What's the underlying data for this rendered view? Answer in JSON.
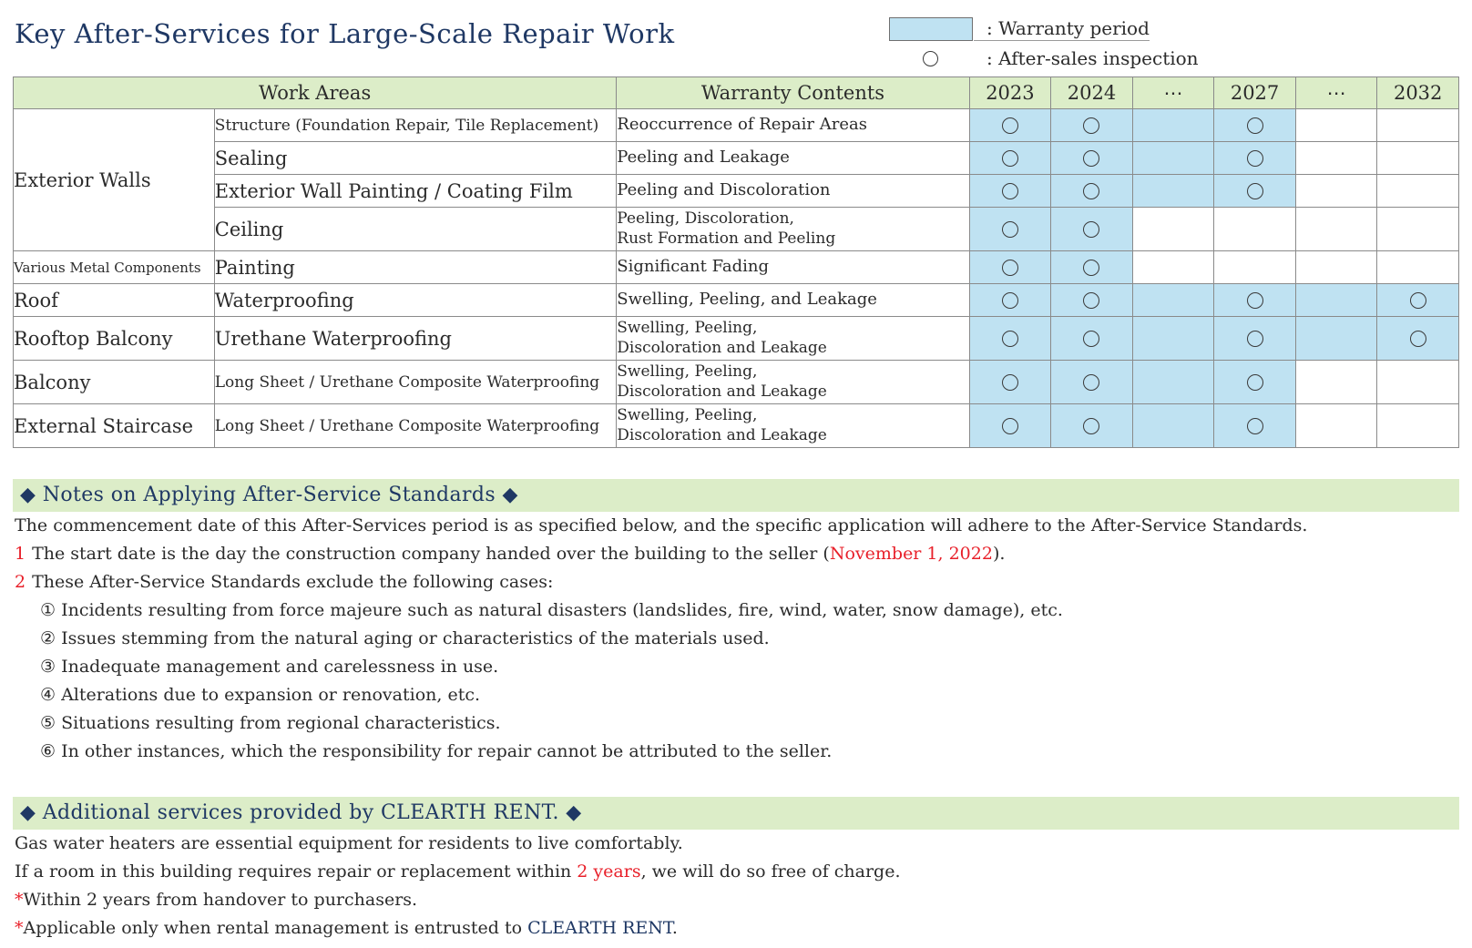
{
  "title": "Key After-Services for Large-Scale Repair Work",
  "legend": [
    {
      "type": "swatch",
      "text": ": Warranty period"
    },
    {
      "type": "circle",
      "text": ": After-sales inspection"
    }
  ],
  "table": {
    "headers": {
      "work_areas": "Work Areas",
      "warranty_contents": "Warranty Contents",
      "years": [
        "2023",
        "2024",
        "⋯",
        "2027",
        "⋯",
        "2032"
      ]
    },
    "rows": [
      {
        "area": "Exterior Walls",
        "area_rowspan": 4,
        "area_small": false,
        "sub": "Structure (Foundation Repair, Tile Replacement)",
        "sub_small": true,
        "warranty": "Reoccurrence of Repair Areas",
        "warranty_line2": "",
        "fill": [
          true,
          true,
          true,
          true,
          false,
          false
        ],
        "marks": [
          true,
          true,
          false,
          true,
          false,
          false
        ]
      },
      {
        "area": "",
        "sub": "Sealing",
        "sub_small": false,
        "warranty": "Peeling and Leakage",
        "warranty_line2": "",
        "fill": [
          true,
          true,
          true,
          true,
          false,
          false
        ],
        "marks": [
          true,
          true,
          false,
          true,
          false,
          false
        ]
      },
      {
        "area": "",
        "sub": "Exterior Wall Painting / Coating Film",
        "sub_small": false,
        "warranty": "Peeling and Discoloration",
        "warranty_line2": "",
        "fill": [
          true,
          true,
          true,
          true,
          false,
          false
        ],
        "marks": [
          true,
          true,
          false,
          true,
          false,
          false
        ]
      },
      {
        "area": "",
        "sub": "Ceiling",
        "sub_small": false,
        "warranty": "Peeling, Discoloration,",
        "warranty_line2": "Rust Formation and Peeling",
        "fill": [
          true,
          true,
          false,
          false,
          false,
          false
        ],
        "marks": [
          true,
          true,
          false,
          false,
          false,
          false
        ]
      },
      {
        "area": "Various Metal Components",
        "area_rowspan": 1,
        "area_small": true,
        "sub": "Painting",
        "sub_small": false,
        "warranty": "Significant Fading",
        "warranty_line2": "",
        "fill": [
          true,
          true,
          false,
          false,
          false,
          false
        ],
        "marks": [
          true,
          true,
          false,
          false,
          false,
          false
        ]
      },
      {
        "area": "Roof",
        "area_rowspan": 1,
        "area_small": false,
        "sub": "Waterproofing",
        "sub_small": false,
        "warranty": "Swelling, Peeling, and Leakage",
        "warranty_line2": "",
        "fill": [
          true,
          true,
          true,
          true,
          true,
          true
        ],
        "marks": [
          true,
          true,
          false,
          true,
          false,
          true
        ]
      },
      {
        "area": "Rooftop Balcony",
        "area_rowspan": 1,
        "area_small": false,
        "sub": "Urethane Waterproofing",
        "sub_small": false,
        "warranty": "Swelling, Peeling,",
        "warranty_line2": "Discoloration and Leakage",
        "fill": [
          true,
          true,
          true,
          true,
          true,
          true
        ],
        "marks": [
          true,
          true,
          false,
          true,
          false,
          true
        ]
      },
      {
        "area": "Balcony",
        "area_rowspan": 1,
        "area_small": false,
        "sub": "Long Sheet / Urethane Composite Waterproofing",
        "sub_small": true,
        "warranty": "Swelling, Peeling,",
        "warranty_line2": "Discoloration and Leakage",
        "fill": [
          true,
          true,
          true,
          true,
          false,
          false
        ],
        "marks": [
          true,
          true,
          false,
          true,
          false,
          false
        ]
      },
      {
        "area": "External Staircase",
        "area_rowspan": 1,
        "area_small": false,
        "sub": "Long Sheet / Urethane Composite Waterproofing",
        "sub_small": true,
        "warranty": "Swelling, Peeling,",
        "warranty_line2": "Discoloration and Leakage",
        "fill": [
          true,
          true,
          true,
          true,
          false,
          false
        ],
        "marks": [
          true,
          true,
          false,
          true,
          false,
          false
        ]
      }
    ]
  },
  "notes": {
    "heading": "◆ Notes on Applying After-Service Standards ◆",
    "intro": "The commencement date of this After-Services period is as specified below, and the specific application will adhere to the After-Service Standards.",
    "item1_num": "1",
    "item1_a": "The start date is the day the construction company handed over the building to the seller (",
    "item1_red": "November 1, 2022",
    "item1_b": ").",
    "item2_num": "2",
    "item2": "These After-Service Standards exclude the following cases:",
    "exclusions": [
      "① Incidents resulting from force majeure such as natural disasters (landslides, fire, wind, water, snow damage), etc.",
      "② Issues stemming from the natural aging or characteristics of the materials used.",
      "③ Inadequate management and carelessness in use.",
      "④ Alterations due to expansion or renovation, etc.",
      "⑤ Situations resulting from regional characteristics.",
      "⑥ In other instances, which the responsibility for repair cannot be attributed to the seller."
    ]
  },
  "additional": {
    "heading": "◆ Additional services provided by CLEARTH RENT. ◆",
    "line1": "Gas water heaters are essential equipment for residents to live comfortably.",
    "line2_a": "If a room in this building requires repair or replacement within ",
    "line2_red": "2 years",
    "line2_b": ", we will do so free of charge.",
    "line3_star": "*",
    "line3": "Within 2 years from handover to purchasers.",
    "line4_star": "*",
    "line4_a": "Applicable only when rental management is entrusted to ",
    "line4_navy": "CLEARTH RENT",
    "line4_b": "."
  },
  "colors": {
    "title_navy": "#1f3864",
    "header_green": "#dcedc8",
    "warranty_blue": "#bfe2f2",
    "accent_red": "#e8202a"
  }
}
